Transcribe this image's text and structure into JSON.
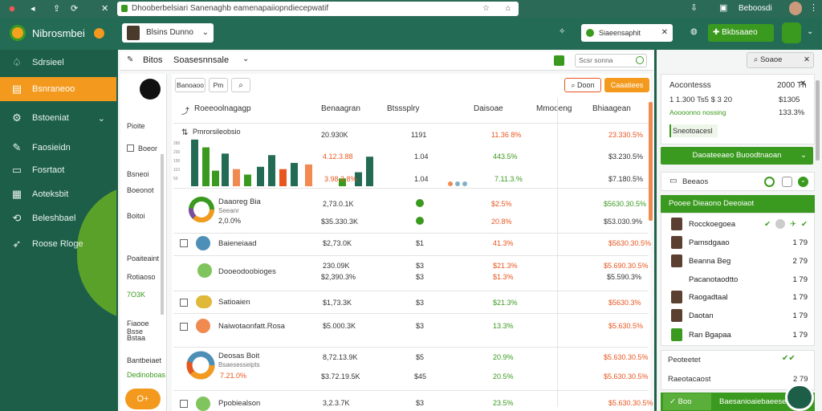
{
  "browser": {
    "url": "Dhooberbelsiari Sanenaghb eamenapaiiopndiecepwatif",
    "user": "Beboosdi"
  },
  "app": {
    "brand": "Nibrosmbei",
    "profile_select": "Blsins Dunno",
    "search_placeholder": "Siaeensaphit",
    "button_label": "Bkbsaaeo"
  },
  "sidebar": {
    "items": [
      {
        "label": "Sdrsieel",
        "icon": "bell-icon"
      },
      {
        "label": "Bsnraneoo",
        "icon": "briefcase-icon",
        "active": true
      },
      {
        "label": "Bstoeniat",
        "icon": "gear-icon"
      },
      {
        "label": "Faosieidn",
        "icon": "edit-icon"
      },
      {
        "label": "Fosrtaot",
        "icon": "document-icon"
      },
      {
        "label": "Aoteksbit",
        "icon": "folder-icon"
      },
      {
        "label": "Beleshbael",
        "icon": "refresh-icon"
      },
      {
        "label": "Roose Rloge",
        "icon": "rocket-icon"
      }
    ]
  },
  "main": {
    "title": "Bitos",
    "title2": "Soasesnnsale",
    "filter_placeholder": "Scsr sonna",
    "btn_clear": "Doon",
    "btn_primary": "Caaatiees",
    "tool1": "Banoaoo",
    "tool2": "Pm"
  },
  "subpanel": {
    "items": [
      "Pioite",
      "Boeor",
      "Bsneoi",
      "Boeonot",
      "Boitoi",
      "Poaiteaint",
      "Rotiaoso",
      "7O3K",
      "Fiaooe Bsse",
      "Bstaa",
      "Bantbeiaet",
      "Dedinoboas"
    ],
    "fab": "O+"
  },
  "table": {
    "headers": [
      "Roeeoolnagagp",
      "Benaagran",
      "Btsssplry",
      "Daisoae",
      "Mmooeng",
      "Bhiaagean"
    ],
    "chart_title": "Pmrorsileobsio",
    "chart_ticks": [
      "280",
      "230",
      "150",
      "110",
      "50"
    ],
    "chart_values": [
      {
        "v": 60,
        "c": "#236b55"
      },
      {
        "v": 50,
        "c": "#3a9a1f"
      },
      {
        "v": 20,
        "c": "#3a9a1f"
      },
      {
        "v": 42,
        "c": "#236b55"
      },
      {
        "v": 22,
        "c": "#f08a50"
      },
      {
        "v": 15,
        "c": "#3a9a1f"
      },
      {
        "v": 25,
        "c": "#236b55"
      },
      {
        "v": 40,
        "c": "#236b55"
      },
      {
        "v": 22,
        "c": "#e8561f"
      },
      {
        "v": 30,
        "c": "#236b55"
      },
      {
        "v": 28,
        "c": "#f08a50"
      },
      {
        "v": 10,
        "c": "#3a9a1f"
      },
      {
        "v": 18,
        "c": "#236b55"
      },
      {
        "v": 38,
        "c": "#236b55"
      }
    ],
    "chart_rows": [
      [
        "20.930K",
        "1191",
        "11.36 8%",
        "23.330.5%"
      ],
      [
        "4.12.3.88",
        "1.04",
        "443.5%",
        "$3.230.5%"
      ],
      [
        "3.98.3.8%",
        "1.04",
        "7.11.3.%",
        "$7.180.5%"
      ]
    ],
    "rows": [
      {
        "name": "Daaoreg Bia",
        "sub": "Seeanr",
        "sub2": "2,0.0%",
        "c1": "2,73.0.1K",
        "c1b": "$35.330.3K",
        "c2": "0",
        "c3": "$2.5%",
        "c3b": "20.8%",
        "c4": "$5630.30.5%",
        "c4b": "$53.030.9%"
      },
      {
        "name": "Baieneiaad",
        "c1": "$2,73.0K",
        "c2": "$1",
        "c3": "41.3%",
        "c4": "$5630.30.5%"
      },
      {
        "name": "Dooeodoobioges",
        "c1": "230.09K",
        "c1b": "$2,390.3%",
        "c2": "$3",
        "c2b": "$3",
        "c3": "$21.3%",
        "c3b": "$1.3%",
        "c4": "$5.690.30.5%",
        "c4b": "$5.590.3%"
      },
      {
        "name": "Satioaien",
        "c1": "$1,73.3K",
        "c2": "$3",
        "c3": "$21.3%",
        "c4": "$5630.3%"
      },
      {
        "name": "Naiwotaonfatt.Rosa",
        "c1": "$5.000.3K",
        "c2": "$3",
        "c3": "13.3%",
        "c4": "$5.630.5%"
      },
      {
        "name": "Deosas Boit",
        "sub": "Bsaesesseipts",
        "sub2": "7.21.0%",
        "c1": "8,72.13.9K",
        "c1b": "$3.72.19.5K",
        "c2": "$5",
        "c2b": "$45",
        "c3": "20.9%",
        "c3b": "20.5%",
        "c4": "$5.630.30.5%",
        "c4b": "$5.630.30.5%"
      },
      {
        "name": "Ppobiealson",
        "c1": "3,2.3.7K",
        "c2": "$3",
        "c3": "23.5%",
        "c4": "$5.630.30.5%"
      }
    ]
  },
  "right": {
    "search": "Soaoe",
    "card1": {
      "title": "Aocontesss",
      "value": "2000 Th",
      "l1": "1 1.300 Ts5 $ 3 20",
      "l1v": "$1305",
      "l2": "Aoooonno nossing",
      "l2v": "133.3%",
      "tag": "Sneotoacesl"
    },
    "green_btn": "Daoateeaeo Buoodtnaoan",
    "card2": {
      "title": "Beeaos"
    },
    "list_header": "Pooee Dieaono Deeoiaot",
    "people": [
      {
        "name": "Rocckoegoea",
        "v": ""
      },
      {
        "name": "Pamsdgaao",
        "v": "1 79"
      },
      {
        "name": "Beanna Beg",
        "v": "2 79"
      },
      {
        "name": "Pacanotaodtto",
        "v": "1 79"
      },
      {
        "name": "Raogadtaal",
        "v": "1 79"
      },
      {
        "name": "Daotan",
        "v": "1 79"
      },
      {
        "name": "Ran Bgapaa",
        "v": "1 79"
      }
    ],
    "f1": "Peoteetet",
    "f2": "Raeotacaost",
    "f2v": "2 79",
    "bottom_btn": "Boo",
    "bottom_btn2": "Baesanioaiebaeeses"
  }
}
